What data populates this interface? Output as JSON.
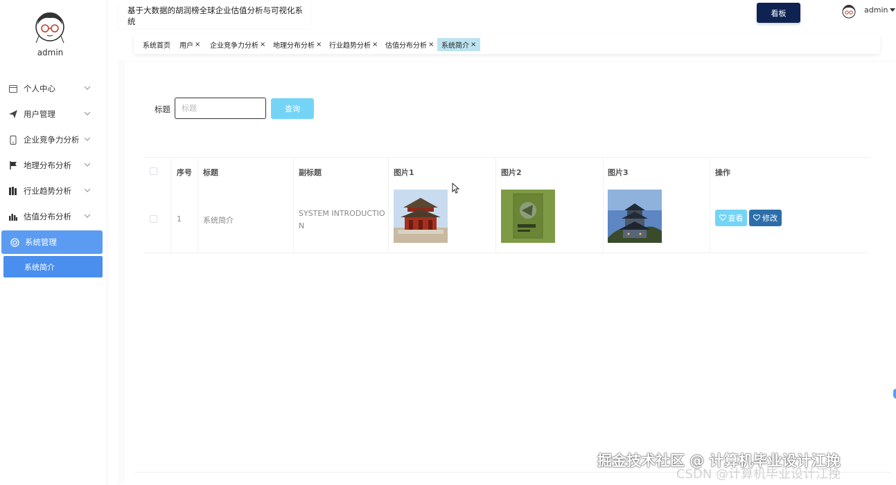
{
  "sidebar": {
    "username": "admin",
    "menu": [
      {
        "label": "个人中心",
        "icon": "card-icon"
      },
      {
        "label": "用户管理",
        "icon": "send-icon"
      },
      {
        "label": "企业竞争力分析",
        "icon": "phone-icon"
      },
      {
        "label": "地理分布分析",
        "icon": "flag-icon"
      },
      {
        "label": "行业趋势分析",
        "icon": "books-icon"
      },
      {
        "label": "估值分布分析",
        "icon": "bar-chart-icon"
      },
      {
        "label": "系统管理",
        "icon": "circle-icon"
      }
    ],
    "submenu": [
      {
        "label": "系统简介"
      }
    ]
  },
  "header": {
    "title": "基于大数据的胡润榜全球企业估值分析与可视化系统",
    "board_button": "看板",
    "username": "admin"
  },
  "tabs": [
    {
      "label": "系统首页",
      "closable": false
    },
    {
      "label": "用户",
      "closable": true
    },
    {
      "label": "企业竞争力分析",
      "closable": true
    },
    {
      "label": "地理分布分析",
      "closable": true
    },
    {
      "label": "行业趋势分析",
      "closable": true
    },
    {
      "label": "估值分布分析",
      "closable": true
    },
    {
      "label": "系统简介",
      "closable": true,
      "active": true
    }
  ],
  "search": {
    "label": "标题",
    "placeholder": "标题",
    "button": "查询"
  },
  "table": {
    "headers": {
      "index": "序号",
      "title": "标题",
      "subtitle": "副标题",
      "image1": "图片1",
      "image2": "图片2",
      "image3": "图片3",
      "actions": "操作"
    },
    "rows": [
      {
        "index": "1",
        "title": "系统简介",
        "subtitle_line1": "SYSTEM INTRODUCTIO",
        "subtitle_line2": "N",
        "view": "查看",
        "edit": "修改"
      }
    ]
  },
  "watermark": {
    "main": "掘金技术社区 @ 计算机毕业设计江挽",
    "sub": "CSDN @计算机毕业设计江挽"
  },
  "colors": {
    "sidebar_active": "#5b9cf2",
    "board_button": "#0e2352",
    "search_button": "#74d4f6",
    "edit_button": "#2c6ea9",
    "active_tab": "#bde3f0"
  }
}
